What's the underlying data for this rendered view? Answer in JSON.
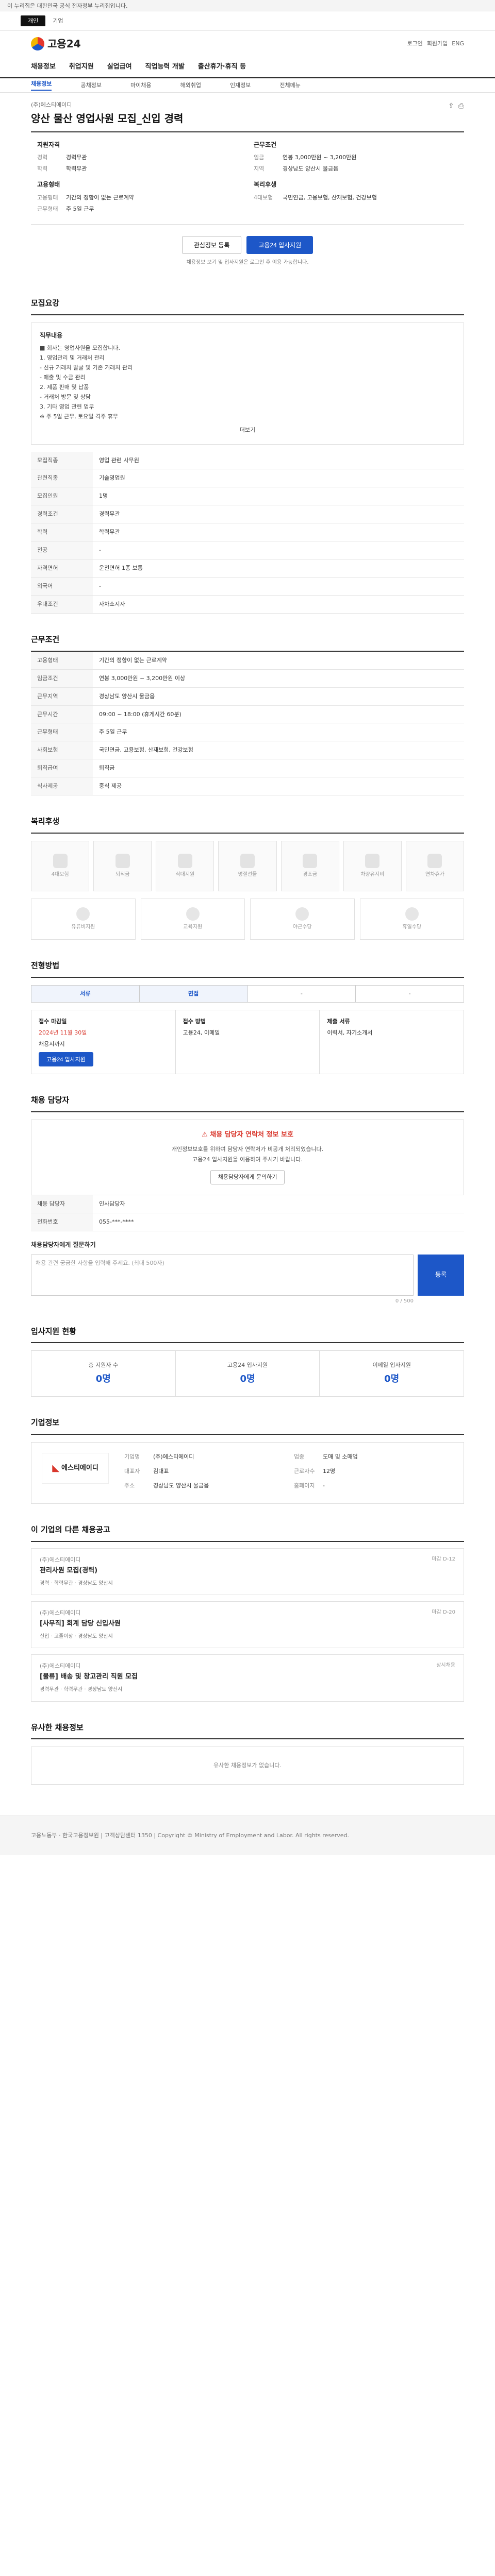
{
  "banner": {
    "text": "이 누리집은 대한민국 공식 전자정부 누리집입니다."
  },
  "topbar": {
    "tabs": [
      "개인",
      "기업"
    ]
  },
  "header": {
    "logo": "고용24",
    "links": [
      "로그인",
      "회원가입",
      "ENG"
    ]
  },
  "gnb": {
    "items": [
      "채용정보",
      "취업지원",
      "실업급여",
      "직업능력 개발",
      "출산휴가·휴직 등"
    ]
  },
  "subnav": {
    "items": [
      "채용정보",
      "공채정보",
      "마이채용",
      "해외취업",
      "인재정보",
      "전체메뉴"
    ]
  },
  "job": {
    "company": "(주)에스티에이디",
    "title": "양산 물산 영업사원 모집_신입 경력",
    "summary_left_head": "지원자격",
    "summary_left": [
      {
        "k": "경력",
        "v": "경력무관"
      },
      {
        "k": "학력",
        "v": "학력무관"
      }
    ],
    "summary_mid_head": "근무조건",
    "summary_mid": [
      {
        "k": "임금",
        "v": "연봉 3,000만원 ~ 3,200만원"
      },
      {
        "k": "지역",
        "v": "경상남도 양산시 물금읍"
      }
    ],
    "summary_extra_head": "고용형태",
    "summary_extra": [
      {
        "k": "고용형태",
        "v": "기간의 정함이 없는 근로계약"
      },
      {
        "k": "근무형태",
        "v": "주 5일 근무"
      }
    ],
    "summary_right_head": "복리후생",
    "summary_right": [
      {
        "k": "4대보험",
        "v": "국민연금, 고용보험, 산재보험, 건강보험"
      }
    ]
  },
  "actions": {
    "scrap": "관심정보 등록",
    "apply": "고용24 입사지원",
    "notice": "채용정보 보기 및 입사지원은 로그인 후 이용 가능합니다."
  },
  "sections": {
    "recruit": "모집요강",
    "condition": "근무조건",
    "welfare": "복리후생",
    "docs": "전형방법",
    "contact": "채용 담당자",
    "stats": "입사지원 현황",
    "company": "기업정보",
    "related": "이 기업의 다른 채용공고",
    "similar": "유사한 채용정보"
  },
  "duty": {
    "head": "직무내용",
    "lines": [
      "■ 회사는 영업사원을 모집합니다.",
      "1. 영업관리 및 거래처 관리",
      "- 신규 거래처 발굴 및 기존 거래처 관리",
      "- 매출 및 수금 관리",
      "2. 제품 판매 및 납품",
      "- 거래처 방문 및 상담",
      "3. 기타 영업 관련 업무",
      "※ 주 5일 근무, 토요일 격주 휴무"
    ],
    "more": "더보기"
  },
  "recruit_table": [
    {
      "k": "모집직종",
      "v": "영업 관련 사무원"
    },
    {
      "k": "관련직종",
      "v": "기술영업원"
    },
    {
      "k": "모집인원",
      "v": "1명"
    },
    {
      "k": "경력조건",
      "v": "경력무관"
    },
    {
      "k": "학력",
      "v": "학력무관"
    },
    {
      "k": "전공",
      "v": "-"
    },
    {
      "k": "자격면허",
      "v": "운전면허 1종 보통"
    },
    {
      "k": "외국어",
      "v": "-"
    },
    {
      "k": "우대조건",
      "v": "자차소지자"
    }
  ],
  "condition_table": [
    {
      "k": "고용형태",
      "v": "기간의 정함이 없는 근로계약"
    },
    {
      "k": "임금조건",
      "v": "연봉 3,000만원 ~ 3,200만원 이상"
    },
    {
      "k": "근무지역",
      "v": "경상남도 양산시 물금읍"
    },
    {
      "k": "근무시간",
      "v": "09:00 ~ 18:00 (휴게시간 60분)"
    },
    {
      "k": "근무형태",
      "v": "주 5일 근무"
    },
    {
      "k": "사회보험",
      "v": "국민연금, 고용보험, 산재보험, 건강보험"
    },
    {
      "k": "퇴직급여",
      "v": "퇴직금"
    },
    {
      "k": "식사제공",
      "v": "중식 제공"
    }
  ],
  "welfare_items": [
    "4대보험",
    "퇴직금",
    "식대지원",
    "명절선물",
    "경조금",
    "차량유지비",
    "연차휴가"
  ],
  "benefit_items": [
    "유류비지원",
    "교육지원",
    "야근수당",
    "휴일수당"
  ],
  "selection": {
    "toggles": [
      "서류",
      "면접",
      "-",
      "-"
    ],
    "steps": [
      {
        "lbl": "접수 마감일",
        "date": "2024년 11월 30일",
        "note": "채용시까지"
      },
      {
        "lbl": "접수 방법",
        "date": "",
        "note": "고용24, 이메일"
      },
      {
        "lbl": "제출 서류",
        "date": "",
        "note": "이력서, 자기소개서"
      }
    ]
  },
  "contact": {
    "alert": "채용 담당자 연락처 정보 보호",
    "lines": [
      "개인정보보호를 위하여 담당자 연락처가 비공개 처리되었습니다.",
      "고용24 입사지원을 이용하여 주시기 바랍니다."
    ],
    "btn": "채용담당자에게 문의하기",
    "rows": [
      {
        "k": "채용 담당자",
        "v": "인사담당자"
      },
      {
        "k": "전화번호",
        "v": "055-***-****"
      }
    ]
  },
  "inquiry": {
    "title": "채용담당자에게 질문하기",
    "placeholder": "채용 관련 궁금한 사항을 입력해 주세요. (최대 500자)",
    "submit": "등록",
    "counter": "0 / 500"
  },
  "stats": [
    {
      "lbl": "총 지원자 수",
      "num": "0명"
    },
    {
      "lbl": "고용24 입사지원",
      "num": "0명"
    },
    {
      "lbl": "이메일 입사지원",
      "num": "0명"
    }
  ],
  "company": {
    "logo": "에스티에이디",
    "rows": [
      {
        "k": "기업명",
        "v": "(주)에스티에이디"
      },
      {
        "k": "업종",
        "v": "도매 및 소매업"
      },
      {
        "k": "대표자",
        "v": "김대표"
      },
      {
        "k": "근로자수",
        "v": "12명"
      },
      {
        "k": "주소",
        "v": "경상남도 양산시 물금읍"
      },
      {
        "k": "홈페이지",
        "v": "-"
      }
    ]
  },
  "related": [
    {
      "co": "(주)에스티에이디",
      "title": "관리사원 모집(경력)",
      "meta": "경력 · 학력무관 · 경상남도 양산시",
      "side": "마감 D-12"
    },
    {
      "co": "(주)에스티에이디",
      "title": "[사무직] 회계 담당 신입사원",
      "meta": "신입 · 고졸이상 · 경상남도 양산시",
      "side": "마감 D-20"
    },
    {
      "co": "(주)에스티에이디",
      "title": "[물류] 배송 및 창고관리 직원 모집",
      "meta": "경력무관 · 학력무관 · 경상남도 양산시",
      "side": "상시채용"
    }
  ],
  "similar": {
    "empty": "유사한 채용정보가 없습니다."
  },
  "footer": {
    "text": "고용노동부 · 한국고용정보원 | 고객상담센터 1350 | Copyright © Ministry of Employment and Labor. All rights reserved."
  }
}
